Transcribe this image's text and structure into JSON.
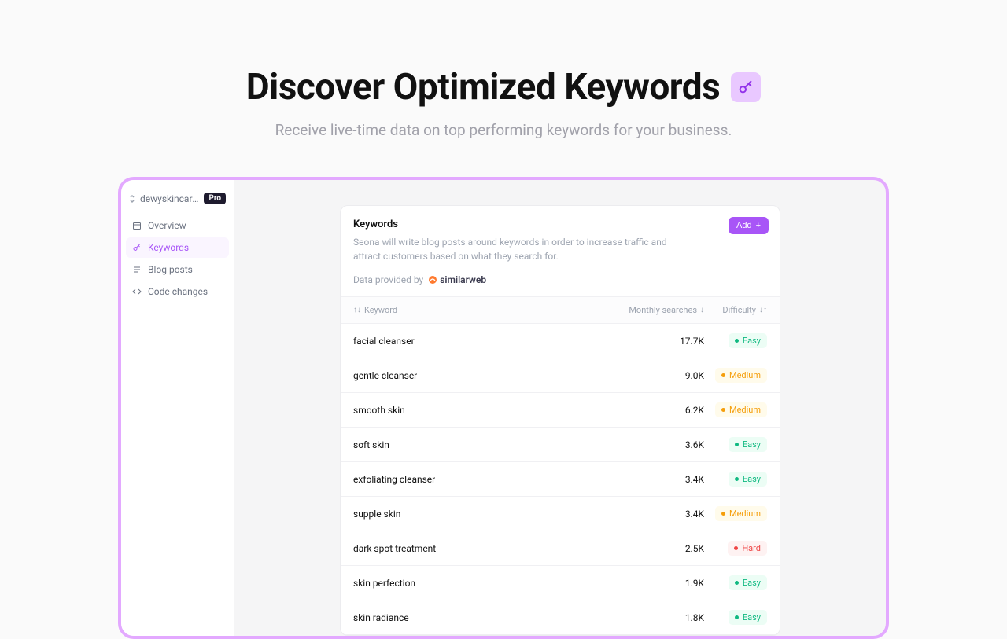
{
  "hero": {
    "title": "Discover Optimized Keywords",
    "subtitle": "Receive live-time data on top performing keywords for your business."
  },
  "sidebar": {
    "site_name": "dewyskincare.st...",
    "pro_badge": "Pro",
    "items": [
      {
        "label": "Overview",
        "icon": "calendar-icon"
      },
      {
        "label": "Keywords",
        "icon": "key-icon"
      },
      {
        "label": "Blog posts",
        "icon": "list-icon"
      },
      {
        "label": "Code changes",
        "icon": "code-icon"
      }
    ],
    "active_index": 1
  },
  "card": {
    "title": "Keywords",
    "description": "Seona will write blog posts around keywords in order to increase traffic and attract customers based on what they search for.",
    "data_by_label": "Data provided by",
    "provider": "similarweb",
    "add_label": "Add"
  },
  "table": {
    "columns": {
      "keyword": "Keyword",
      "monthly": "Monthly searches",
      "difficulty": "Difficulty"
    },
    "rows": [
      {
        "keyword": "facial cleanser",
        "monthly": "17.7K",
        "difficulty": "Easy"
      },
      {
        "keyword": "gentle cleanser",
        "monthly": "9.0K",
        "difficulty": "Medium"
      },
      {
        "keyword": "smooth skin",
        "monthly": "6.2K",
        "difficulty": "Medium"
      },
      {
        "keyword": "soft skin",
        "monthly": "3.6K",
        "difficulty": "Easy"
      },
      {
        "keyword": "exfoliating cleanser",
        "monthly": "3.4K",
        "difficulty": "Easy"
      },
      {
        "keyword": "supple skin",
        "monthly": "3.4K",
        "difficulty": "Medium"
      },
      {
        "keyword": "dark spot treatment",
        "monthly": "2.5K",
        "difficulty": "Hard"
      },
      {
        "keyword": "skin perfection",
        "monthly": "1.9K",
        "difficulty": "Easy"
      },
      {
        "keyword": "skin radiance",
        "monthly": "1.8K",
        "difficulty": "Easy"
      }
    ]
  }
}
